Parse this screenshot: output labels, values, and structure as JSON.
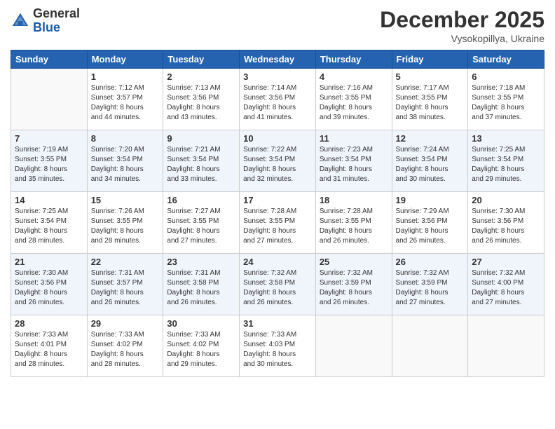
{
  "logo": {
    "general": "General",
    "blue": "Blue"
  },
  "header": {
    "month": "December 2025",
    "location": "Vysokopillya, Ukraine"
  },
  "weekdays": [
    "Sunday",
    "Monday",
    "Tuesday",
    "Wednesday",
    "Thursday",
    "Friday",
    "Saturday"
  ],
  "weeks": [
    [
      {
        "day": "",
        "info": ""
      },
      {
        "day": "1",
        "info": "Sunrise: 7:12 AM\nSunset: 3:57 PM\nDaylight: 8 hours\nand 44 minutes."
      },
      {
        "day": "2",
        "info": "Sunrise: 7:13 AM\nSunset: 3:56 PM\nDaylight: 8 hours\nand 43 minutes."
      },
      {
        "day": "3",
        "info": "Sunrise: 7:14 AM\nSunset: 3:56 PM\nDaylight: 8 hours\nand 41 minutes."
      },
      {
        "day": "4",
        "info": "Sunrise: 7:16 AM\nSunset: 3:55 PM\nDaylight: 8 hours\nand 39 minutes."
      },
      {
        "day": "5",
        "info": "Sunrise: 7:17 AM\nSunset: 3:55 PM\nDaylight: 8 hours\nand 38 minutes."
      },
      {
        "day": "6",
        "info": "Sunrise: 7:18 AM\nSunset: 3:55 PM\nDaylight: 8 hours\nand 37 minutes."
      }
    ],
    [
      {
        "day": "7",
        "info": "Sunrise: 7:19 AM\nSunset: 3:55 PM\nDaylight: 8 hours\nand 35 minutes."
      },
      {
        "day": "8",
        "info": "Sunrise: 7:20 AM\nSunset: 3:54 PM\nDaylight: 8 hours\nand 34 minutes."
      },
      {
        "day": "9",
        "info": "Sunrise: 7:21 AM\nSunset: 3:54 PM\nDaylight: 8 hours\nand 33 minutes."
      },
      {
        "day": "10",
        "info": "Sunrise: 7:22 AM\nSunset: 3:54 PM\nDaylight: 8 hours\nand 32 minutes."
      },
      {
        "day": "11",
        "info": "Sunrise: 7:23 AM\nSunset: 3:54 PM\nDaylight: 8 hours\nand 31 minutes."
      },
      {
        "day": "12",
        "info": "Sunrise: 7:24 AM\nSunset: 3:54 PM\nDaylight: 8 hours\nand 30 minutes."
      },
      {
        "day": "13",
        "info": "Sunrise: 7:25 AM\nSunset: 3:54 PM\nDaylight: 8 hours\nand 29 minutes."
      }
    ],
    [
      {
        "day": "14",
        "info": "Sunrise: 7:25 AM\nSunset: 3:54 PM\nDaylight: 8 hours\nand 28 minutes."
      },
      {
        "day": "15",
        "info": "Sunrise: 7:26 AM\nSunset: 3:55 PM\nDaylight: 8 hours\nand 28 minutes."
      },
      {
        "day": "16",
        "info": "Sunrise: 7:27 AM\nSunset: 3:55 PM\nDaylight: 8 hours\nand 27 minutes."
      },
      {
        "day": "17",
        "info": "Sunrise: 7:28 AM\nSunset: 3:55 PM\nDaylight: 8 hours\nand 27 minutes."
      },
      {
        "day": "18",
        "info": "Sunrise: 7:28 AM\nSunset: 3:55 PM\nDaylight: 8 hours\nand 26 minutes."
      },
      {
        "day": "19",
        "info": "Sunrise: 7:29 AM\nSunset: 3:56 PM\nDaylight: 8 hours\nand 26 minutes."
      },
      {
        "day": "20",
        "info": "Sunrise: 7:30 AM\nSunset: 3:56 PM\nDaylight: 8 hours\nand 26 minutes."
      }
    ],
    [
      {
        "day": "21",
        "info": "Sunrise: 7:30 AM\nSunset: 3:56 PM\nDaylight: 8 hours\nand 26 minutes."
      },
      {
        "day": "22",
        "info": "Sunrise: 7:31 AM\nSunset: 3:57 PM\nDaylight: 8 hours\nand 26 minutes."
      },
      {
        "day": "23",
        "info": "Sunrise: 7:31 AM\nSunset: 3:58 PM\nDaylight: 8 hours\nand 26 minutes."
      },
      {
        "day": "24",
        "info": "Sunrise: 7:32 AM\nSunset: 3:58 PM\nDaylight: 8 hours\nand 26 minutes."
      },
      {
        "day": "25",
        "info": "Sunrise: 7:32 AM\nSunset: 3:59 PM\nDaylight: 8 hours\nand 26 minutes."
      },
      {
        "day": "26",
        "info": "Sunrise: 7:32 AM\nSunset: 3:59 PM\nDaylight: 8 hours\nand 27 minutes."
      },
      {
        "day": "27",
        "info": "Sunrise: 7:32 AM\nSunset: 4:00 PM\nDaylight: 8 hours\nand 27 minutes."
      }
    ],
    [
      {
        "day": "28",
        "info": "Sunrise: 7:33 AM\nSunset: 4:01 PM\nDaylight: 8 hours\nand 28 minutes."
      },
      {
        "day": "29",
        "info": "Sunrise: 7:33 AM\nSunset: 4:02 PM\nDaylight: 8 hours\nand 28 minutes."
      },
      {
        "day": "30",
        "info": "Sunrise: 7:33 AM\nSunset: 4:02 PM\nDaylight: 8 hours\nand 29 minutes."
      },
      {
        "day": "31",
        "info": "Sunrise: 7:33 AM\nSunset: 4:03 PM\nDaylight: 8 hours\nand 30 minutes."
      },
      {
        "day": "",
        "info": ""
      },
      {
        "day": "",
        "info": ""
      },
      {
        "day": "",
        "info": ""
      }
    ]
  ]
}
